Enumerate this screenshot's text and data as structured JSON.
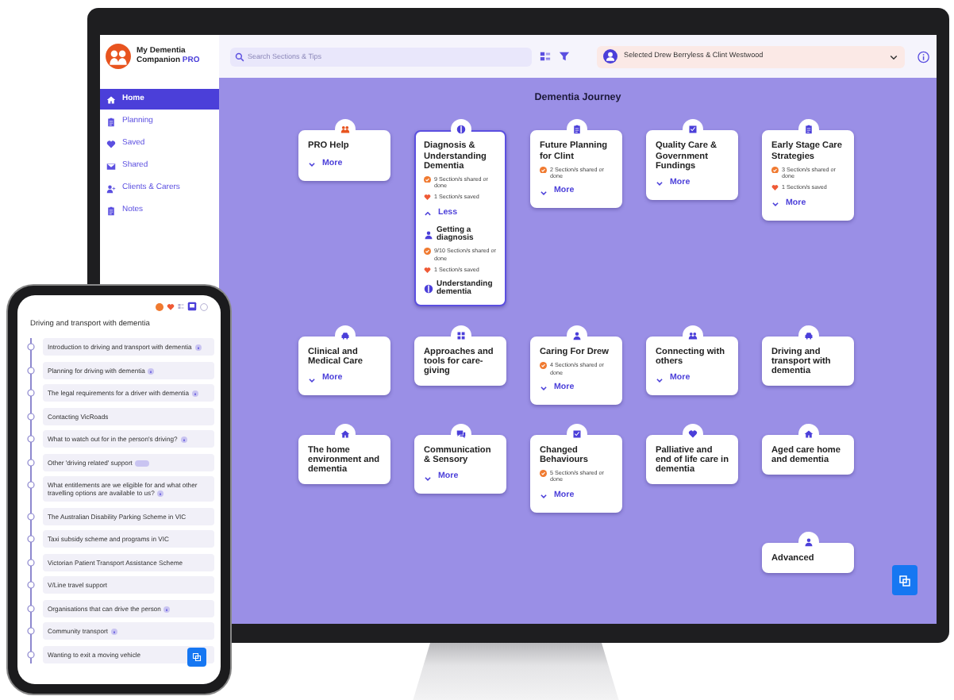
{
  "app": {
    "name": "My Dementia Companion",
    "tier": "PRO"
  },
  "sidebar": {
    "items": [
      {
        "label": "Home",
        "selected": true
      },
      {
        "label": "Planning",
        "selected": false
      },
      {
        "label": "Saved",
        "selected": false
      },
      {
        "label": "Shared",
        "selected": false
      },
      {
        "label": "Clients & Carers",
        "selected": false
      },
      {
        "label": "Notes",
        "selected": false
      }
    ]
  },
  "search": {
    "placeholder": "Search Sections & Tips"
  },
  "client_selector": {
    "value": "Selected Drew Berryless & Clint Westwood"
  },
  "journey": {
    "title": "Dementia Journey",
    "rows": [
      [
        {
          "title": "PRO Help",
          "toggle": {
            "label": "More",
            "expanded": false
          }
        },
        {
          "title": "Diagnosis & Understanding Dementia",
          "stats": [
            {
              "kind": "shared",
              "text": "9 Section/s shared or done"
            },
            {
              "kind": "saved",
              "text": "1 Section/s saved"
            }
          ],
          "toggle": {
            "label": "Less",
            "expanded": true
          },
          "children": [
            {
              "title": "Getting a diagnosis",
              "stats": [
                {
                  "kind": "shared",
                  "text": "9/10 Section/s shared or done"
                },
                {
                  "kind": "saved",
                  "text": "1 Section/s saved"
                }
              ]
            },
            {
              "title": "Understanding dementia"
            }
          ]
        },
        {
          "title": "Future Planning for Clint",
          "stats": [
            {
              "kind": "shared",
              "text": "2 Section/s shared or done"
            }
          ],
          "toggle": {
            "label": "More",
            "expanded": false
          }
        },
        {
          "title": "Quality Care & Government Fundings",
          "toggle": {
            "label": "More",
            "expanded": false
          }
        },
        {
          "title": "Early Stage Care Strategies",
          "stats": [
            {
              "kind": "shared",
              "text": "3 Section/s shared or done"
            },
            {
              "kind": "saved",
              "text": "1 Section/s saved"
            }
          ],
          "toggle": {
            "label": "More",
            "expanded": false
          }
        }
      ],
      [
        {
          "title": "Clinical and Medical Care",
          "toggle": {
            "label": "More",
            "expanded": false
          }
        },
        {
          "title": "Approaches and tools for care-giving"
        },
        {
          "title": "Caring For Drew",
          "stats": [
            {
              "kind": "shared",
              "text": "4 Section/s shared or done"
            }
          ],
          "toggle": {
            "label": "More",
            "expanded": false
          }
        },
        {
          "title": "Connecting with others",
          "toggle": {
            "label": "More",
            "expanded": false
          }
        },
        {
          "title": "Driving and transport with dementia"
        }
      ],
      [
        {
          "title": "The home environment and dementia"
        },
        {
          "title": "Communication & Sensory",
          "toggle": {
            "label": "More",
            "expanded": false
          }
        },
        {
          "title": "Changed Behaviours",
          "stats": [
            {
              "kind": "shared",
              "text": "5 Section/s shared or done"
            }
          ],
          "toggle": {
            "label": "More",
            "expanded": false
          }
        },
        {
          "title": "Palliative and end of life care in dementia"
        },
        {
          "title": "Aged care home and dementia"
        }
      ],
      [
        "",
        "",
        "",
        "",
        {
          "title": "Advanced"
        }
      ]
    ]
  },
  "phone": {
    "title": "Driving and transport with dementia",
    "items": [
      {
        "label": "Introduction to driving and transport with dementia",
        "info": true
      },
      {
        "label": "Planning for driving with dementia",
        "info": true
      },
      {
        "label": "The legal requirements for a driver with dementia",
        "info": true
      },
      {
        "label": "Contacting VicRoads",
        "info": false
      },
      {
        "label": "What to watch out for in the person's driving?",
        "info": true
      },
      {
        "label": "Other 'driving related' support",
        "info": false,
        "tag": true
      },
      {
        "label": "What entitlements are we eligible for and what other travelling options are available to us?",
        "info": true
      },
      {
        "label": "The Australian Disability Parking Scheme in VIC",
        "info": false
      },
      {
        "label": "Taxi subsidy scheme and programs in VIC",
        "info": false
      },
      {
        "label": "Victorian Patient Transport Assistance Scheme",
        "info": false
      },
      {
        "label": "V/Line travel support",
        "info": false
      },
      {
        "label": "Organisations that can drive the person",
        "info": true
      },
      {
        "label": "Community transport",
        "info": true
      },
      {
        "label": "Wanting to exit a moving vehicle",
        "info": false
      }
    ]
  }
}
